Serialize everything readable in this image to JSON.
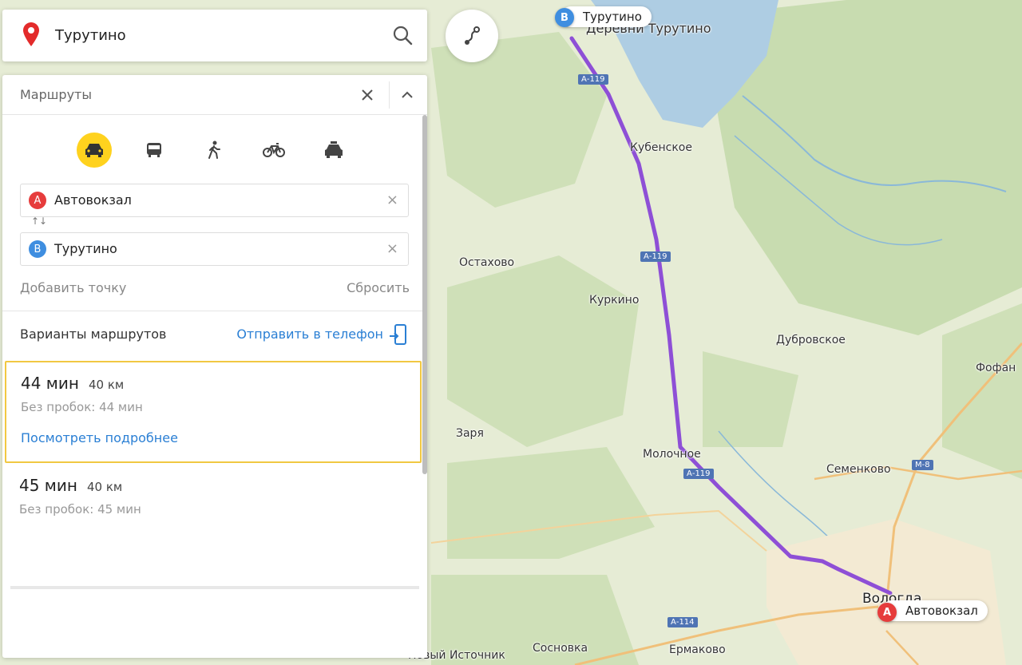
{
  "search": {
    "query": "Турутино"
  },
  "panel": {
    "title": "Маршруты",
    "modes": [
      {
        "icon": "car-icon",
        "active": true
      },
      {
        "icon": "bus-icon",
        "active": false
      },
      {
        "icon": "walk-icon",
        "active": false
      },
      {
        "icon": "bike-icon",
        "active": false
      },
      {
        "icon": "taxi-icon",
        "active": false
      }
    ],
    "from": {
      "letter": "A",
      "value": "Автовокзал"
    },
    "to": {
      "letter": "B",
      "value": "Турутино"
    },
    "swap_label": "↑↓",
    "add_point": "Добавить точку",
    "reset": "Сбросить",
    "variants_title": "Варианты маршрутов",
    "send_to_phone": "Отправить в телефон",
    "routes": [
      {
        "time": "44 мин",
        "distance": "40 км",
        "no_jams": "Без пробок: 44 мин",
        "more": "Посмотреть подробнее"
      },
      {
        "time": "45 мин",
        "distance": "40 км",
        "no_jams": "Без пробок: 45 мин"
      }
    ]
  },
  "map": {
    "route_color": "#8e4fd6",
    "places": {
      "derevni_turutino": "Деревни Турутино",
      "kubenskoe": "Кубенское",
      "ostakhovo": "Остахово",
      "kurkino": "Куркино",
      "dubrovskoe": "Дубровское",
      "fofan": "Фофан",
      "zarya": "Заря",
      "molochnoe": "Молочное",
      "semenkovo": "Семенково",
      "vologda": "Вологда",
      "sosnovka": "Сосновка",
      "ermakovo": "Ермаково",
      "novy_istochnik": "Новый Источник"
    },
    "roads": {
      "a119_1": "А-119",
      "a119_2": "А-119",
      "a119_3": "А-119",
      "m8": "М-8",
      "a114": "А-114"
    },
    "pin_a": {
      "letter": "A",
      "label": "Автовокзал"
    },
    "pin_b": {
      "letter": "B",
      "label": "Турутино"
    }
  }
}
